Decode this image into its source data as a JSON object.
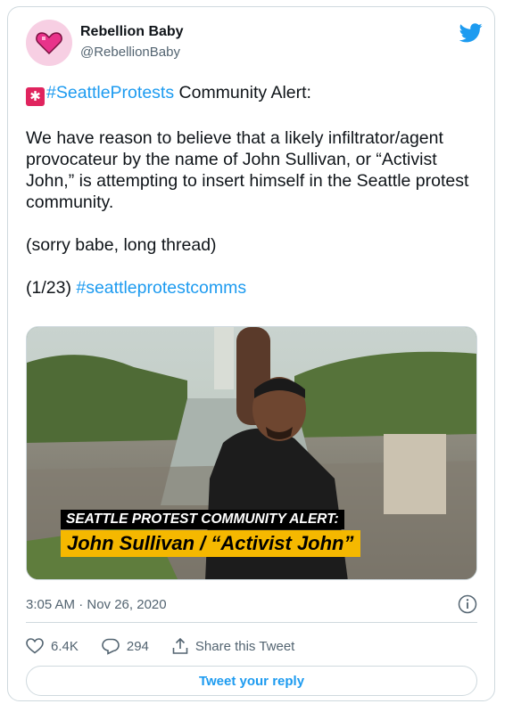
{
  "author": {
    "name": "Rebellion Baby",
    "handle": "@RebellionBaby"
  },
  "tweet": {
    "hashtag1": "#SeattleProtests",
    "headline_rest": " Community Alert:",
    "paragraph2": "We have reason to believe that a likely infiltrator/agent provocateur by the name of John Sullivan, or “Activist John,” is attempting to insert himself in the Seattle protest community.",
    "paragraph3": "(sorry babe, long thread)",
    "thread_count": "(1/23) ",
    "hashtag2": "#seattleprotestcomms"
  },
  "media": {
    "alert_text": "SEATTLE PROTEST COMMUNITY ALERT:",
    "name_text": "John Sullivan / “Activist John”"
  },
  "meta": {
    "timestamp": "3:05 AM · Nov 26, 2020"
  },
  "actions": {
    "likes": "6.4K",
    "replies": "294",
    "share_label": "Share this Tweet"
  },
  "reply": {
    "label": "Tweet your reply"
  },
  "colors": {
    "link": "#1d9bf0",
    "text": "#0f1419",
    "muted": "#536471",
    "banner_yellow": "#f5b800"
  },
  "icons": [
    "heart-avatar-icon",
    "twitter-bird-icon",
    "siren-icon",
    "info-icon",
    "heart-icon",
    "reply-icon",
    "share-icon"
  ]
}
